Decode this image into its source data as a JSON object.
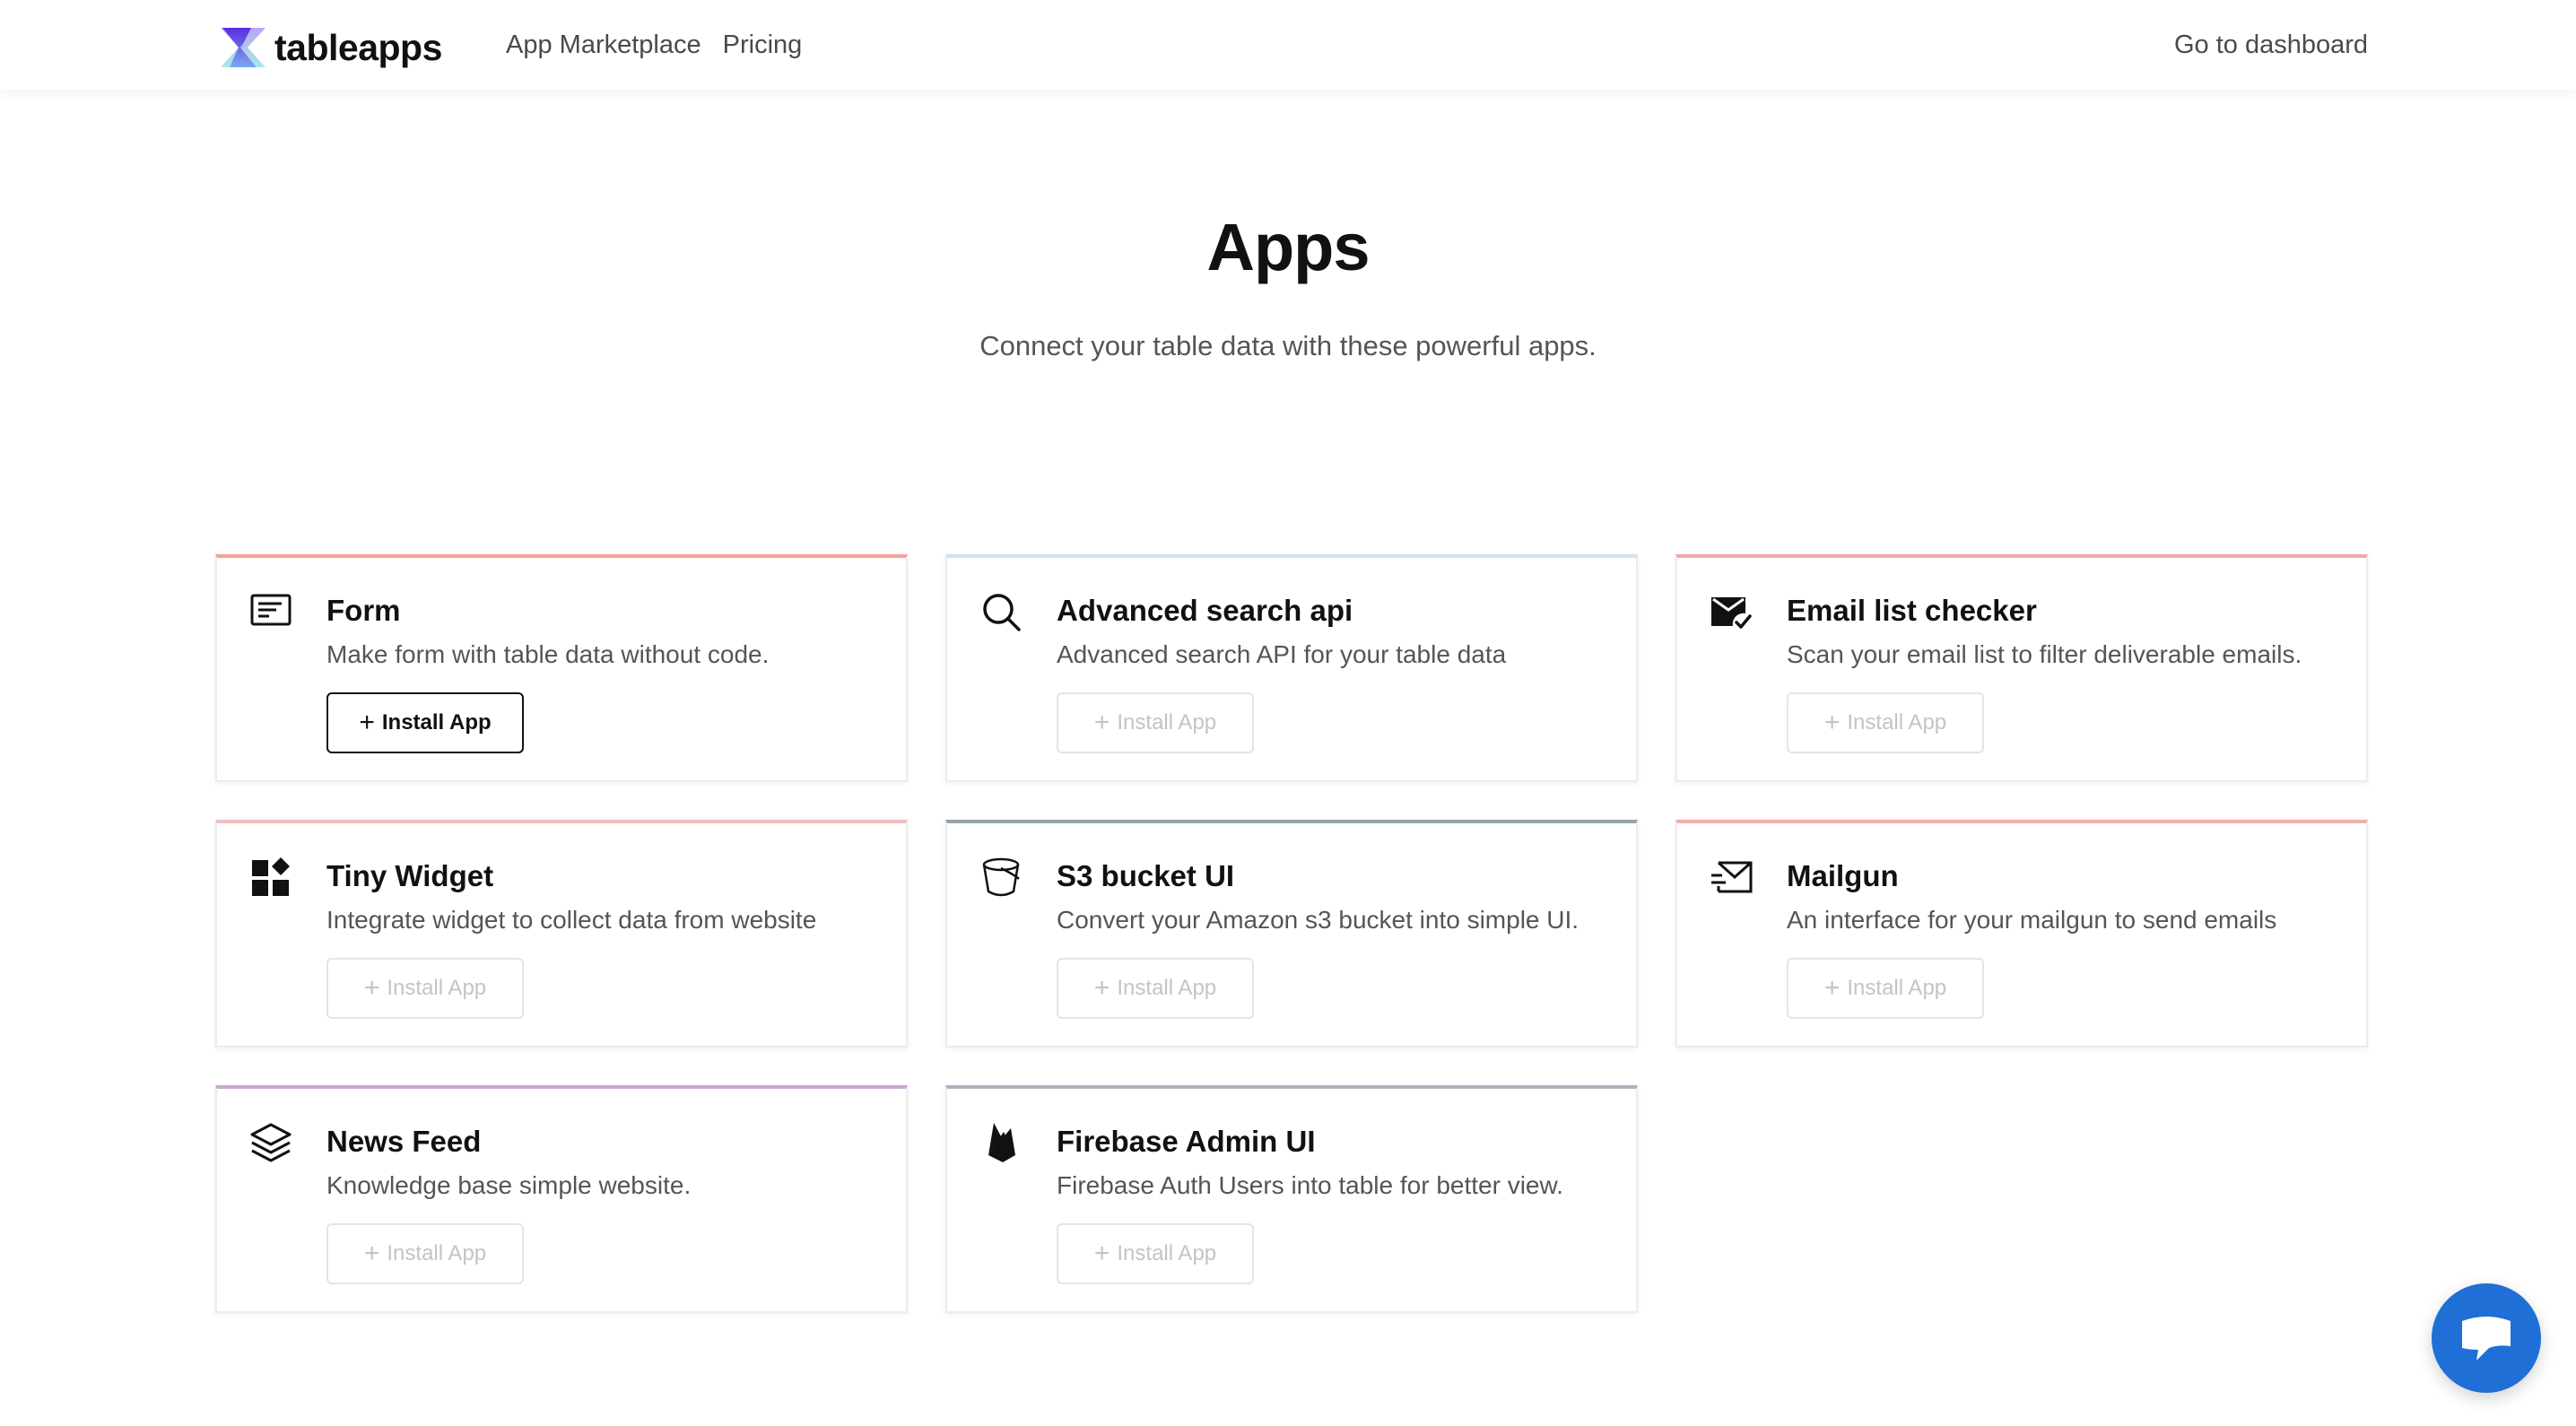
{
  "header": {
    "brand": "tableapps",
    "nav": [
      {
        "label": "App Marketplace"
      },
      {
        "label": "Pricing"
      }
    ],
    "dashboard_link": "Go to dashboard"
  },
  "hero": {
    "title": "Apps",
    "subtitle": "Connect your table data with these powerful apps."
  },
  "apps": [
    {
      "title": "Form",
      "description": "Make form with table data without code.",
      "button_label": "Install App",
      "icon": "form-icon",
      "accent": "#f0a39c",
      "active": true
    },
    {
      "title": "Advanced search api",
      "description": "Advanced search API for your table data",
      "button_label": "Install App",
      "icon": "search-icon",
      "accent": "#cfe4ea",
      "active": false
    },
    {
      "title": "Email list checker",
      "description": "Scan your email list to filter deliverable emails.",
      "button_label": "Install App",
      "icon": "email-check-icon",
      "accent": "#f0aaa3",
      "active": false
    },
    {
      "title": "Tiny Widget",
      "description": "Integrate widget to collect data from website",
      "button_label": "Install App",
      "icon": "widgets-icon",
      "accent": "#efc0c0",
      "active": false
    },
    {
      "title": "S3 bucket UI",
      "description": "Convert your Amazon s3 bucket into simple UI.",
      "button_label": "Install App",
      "icon": "bucket-icon",
      "accent": "#95a3aa",
      "active": false
    },
    {
      "title": "Mailgun",
      "description": "An interface for your mailgun to send emails",
      "button_label": "Install App",
      "icon": "mail-send-icon",
      "accent": "#f0b0ab",
      "active": false
    },
    {
      "title": "News Feed",
      "description": "Knowledge base simple website.",
      "button_label": "Install App",
      "icon": "layers-icon",
      "accent": "#c9a5d4",
      "active": false
    },
    {
      "title": "Firebase Admin UI",
      "description": "Firebase Auth Users into table for better view.",
      "button_label": "Install App",
      "icon": "firebase-icon",
      "accent": "#aab5c3",
      "active": false
    }
  ],
  "colors": {
    "chat_button": "#1f6fd6",
    "logo_purple": "#5b2be0",
    "logo_teal": "#5fd6d1"
  }
}
